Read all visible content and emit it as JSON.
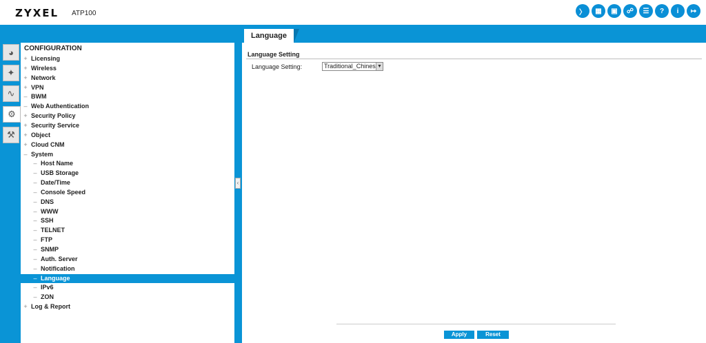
{
  "header": {
    "brand": "ZYXEL",
    "model": "ATP100",
    "icons": [
      "console-icon",
      "cli-icon",
      "site-map-icon",
      "object-reference-icon",
      "dashboard-icon",
      "help-icon",
      "about-icon",
      "logout-icon"
    ],
    "accent_color": "#0a94d6"
  },
  "tab": {
    "label": "Language"
  },
  "sidebar_buttons": [
    "dashboard-icon",
    "quick-setup-icon",
    "monitor-icon",
    "configuration-icon",
    "maintenance-icon"
  ],
  "tree": {
    "title": "CONFIGURATION",
    "items": [
      {
        "sign": "+",
        "label": "Licensing"
      },
      {
        "sign": "+",
        "label": "Wireless"
      },
      {
        "sign": "+",
        "label": "Network"
      },
      {
        "sign": "+",
        "label": "VPN"
      },
      {
        "sign": "–",
        "label": "BWM"
      },
      {
        "sign": "–",
        "label": "Web Authentication"
      },
      {
        "sign": "+",
        "label": "Security Policy"
      },
      {
        "sign": "+",
        "label": "Security Service"
      },
      {
        "sign": "+",
        "label": "Object"
      },
      {
        "sign": "+",
        "label": "Cloud CNM"
      },
      {
        "sign": "–",
        "label": "System"
      },
      {
        "sign": "–",
        "label": "Host Name"
      },
      {
        "sign": "–",
        "label": "USB Storage"
      },
      {
        "sign": "–",
        "label": "Date/Time"
      },
      {
        "sign": "–",
        "label": "Console Speed"
      },
      {
        "sign": "–",
        "label": "DNS"
      },
      {
        "sign": "–",
        "label": "WWW"
      },
      {
        "sign": "–",
        "label": "SSH"
      },
      {
        "sign": "–",
        "label": "TELNET"
      },
      {
        "sign": "–",
        "label": "FTP"
      },
      {
        "sign": "–",
        "label": "SNMP"
      },
      {
        "sign": "–",
        "label": "Auth. Server"
      },
      {
        "sign": "–",
        "label": "Notification"
      },
      {
        "sign": "–",
        "label": "Language"
      },
      {
        "sign": "–",
        "label": "IPv6"
      },
      {
        "sign": "–",
        "label": "ZON"
      },
      {
        "sign": "+",
        "label": "Log & Report"
      }
    ],
    "selected": "Language"
  },
  "main": {
    "section_title": "Language Setting",
    "field_label": "Language Setting:",
    "select_value": "Traditional_Chinese",
    "apply_label": "Apply",
    "reset_label": "Reset"
  }
}
